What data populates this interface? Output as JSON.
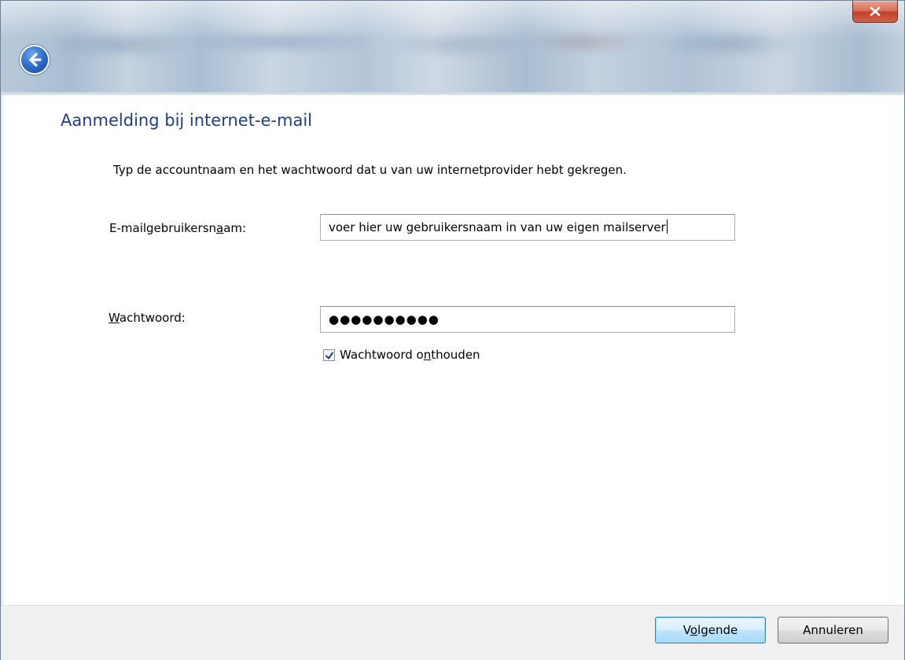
{
  "window": {
    "close_label": "×"
  },
  "header": {
    "title": "Aanmelding bij internet-e-mail",
    "instruction": "Typ de accountnaam en het wachtwoord dat u van uw internetprovider hebt gekregen."
  },
  "form": {
    "username": {
      "label_pre": "E-mailgebruikersn",
      "label_accel": "a",
      "label_post": "am:",
      "value": "voer hier uw gebruikersnaam in van uw eigen mailserver"
    },
    "password": {
      "label_accel": "W",
      "label_post": "achtwoord:",
      "value": "●●●●●●●●●●"
    },
    "remember": {
      "label_pre": "Wachtwoord o",
      "label_accel": "n",
      "label_post": "thouden",
      "checked": true
    }
  },
  "footer": {
    "next_pre": "V",
    "next_accel": "o",
    "next_post": "lgende",
    "cancel_label": "Annuleren"
  },
  "icons": {
    "back": "back-arrow-icon",
    "close": "close-icon",
    "checkmark": "checkmark-icon"
  },
  "colors": {
    "title": "#1f3e8f",
    "close_button": "#c1422b",
    "back_button": "#2a66c4",
    "footer_bg": "#f0f0f0"
  }
}
